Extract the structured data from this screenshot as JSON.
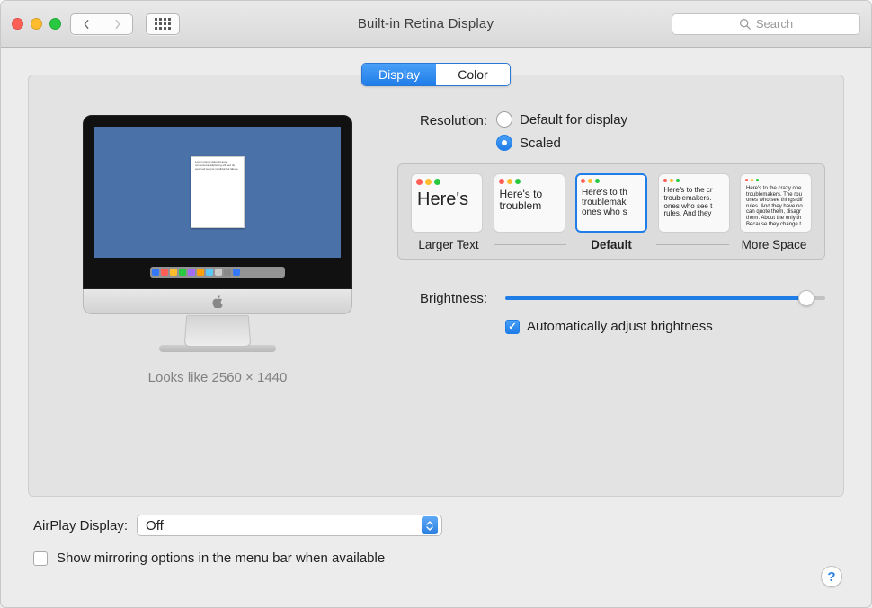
{
  "titlebar": {
    "title": "Built-in Retina Display",
    "search_placeholder": "Search"
  },
  "tabs": {
    "display": "Display",
    "color": "Color",
    "active": "display"
  },
  "preview": {
    "looks_like": "Looks like 2560 × 1440"
  },
  "resolution": {
    "label": "Resolution:",
    "default_option": "Default for display",
    "scaled_option": "Scaled",
    "selected": "scaled",
    "scale_labels": {
      "left": "Larger Text",
      "mid": "Default",
      "right": "More Space"
    },
    "thumbs": [
      {
        "text": "Here's",
        "fs": 20,
        "dot": 7
      },
      {
        "text": "Here's to troublem",
        "fs": 12,
        "dot": 6
      },
      {
        "text": "Here's to th troublemak ones who s",
        "fs": 10,
        "dot": 5,
        "selected": true
      },
      {
        "text": "Here's to the cr troublemakers. ones who see t rules. And they",
        "fs": 8,
        "dot": 4
      },
      {
        "text": "Here's to the crazy one troublemakers. The rou ones who see things dif rules. And they have no can quote them, disagr them. About the only th Because they change t",
        "fs": 6,
        "dot": 3
      }
    ]
  },
  "brightness": {
    "label": "Brightness:",
    "value_pct": 94,
    "auto_label": "Automatically adjust brightness",
    "auto_checked": true
  },
  "airplay": {
    "label": "AirPlay Display:",
    "value": "Off"
  },
  "mirroring": {
    "label": "Show mirroring options in the menu bar when available",
    "checked": false
  },
  "help": "?"
}
